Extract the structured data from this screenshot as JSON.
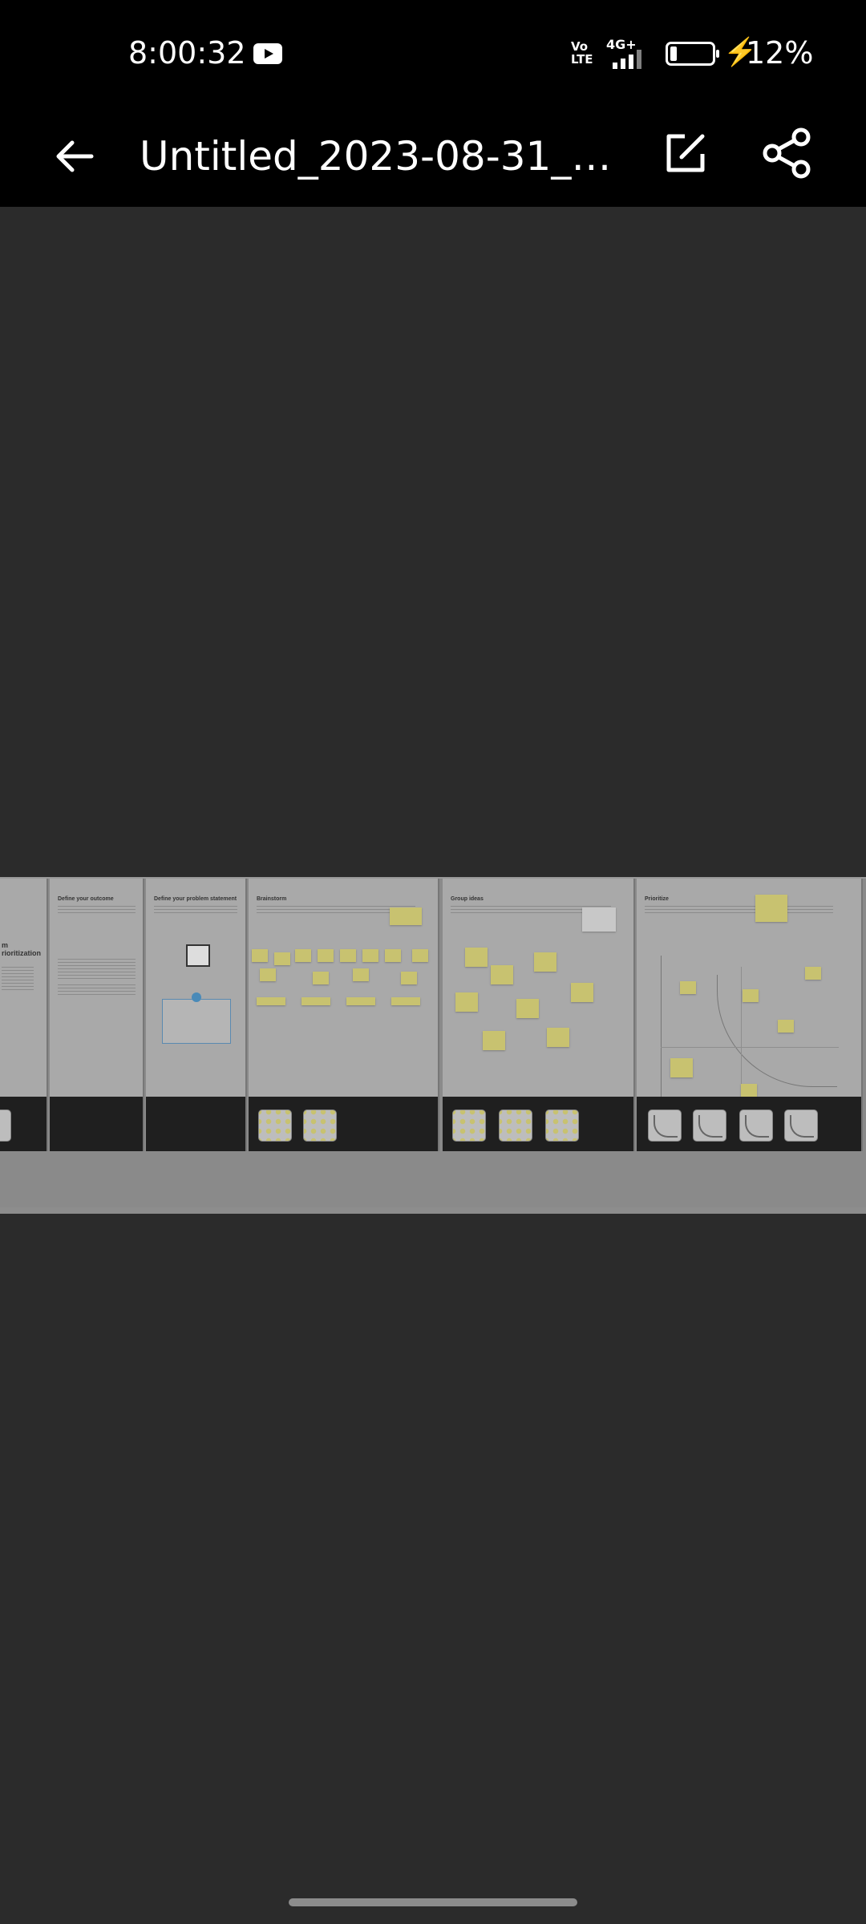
{
  "status": {
    "time": "8:00:32",
    "volte": "Vo\nLTE",
    "network": "4G+",
    "battery": "12%"
  },
  "appbar": {
    "title": "Untitled_2023-08-31_17-…"
  },
  "board": {
    "frames": [
      {
        "heading": "m\nrioritization"
      },
      {
        "heading": "Define your outcome"
      },
      {
        "heading": "Define your problem statement"
      },
      {
        "heading": "Brainstorm"
      },
      {
        "heading": "Group ideas"
      },
      {
        "heading": "Prioritize"
      }
    ]
  },
  "colors": {
    "statusbar": "#000000",
    "background": "#2b2b2b",
    "sticky": "#c8c270"
  },
  "icons": [
    "back-arrow-icon",
    "edit-icon",
    "share-icon",
    "youtube-icon",
    "battery-icon",
    "charging-bolt-icon",
    "signal-icon"
  ]
}
